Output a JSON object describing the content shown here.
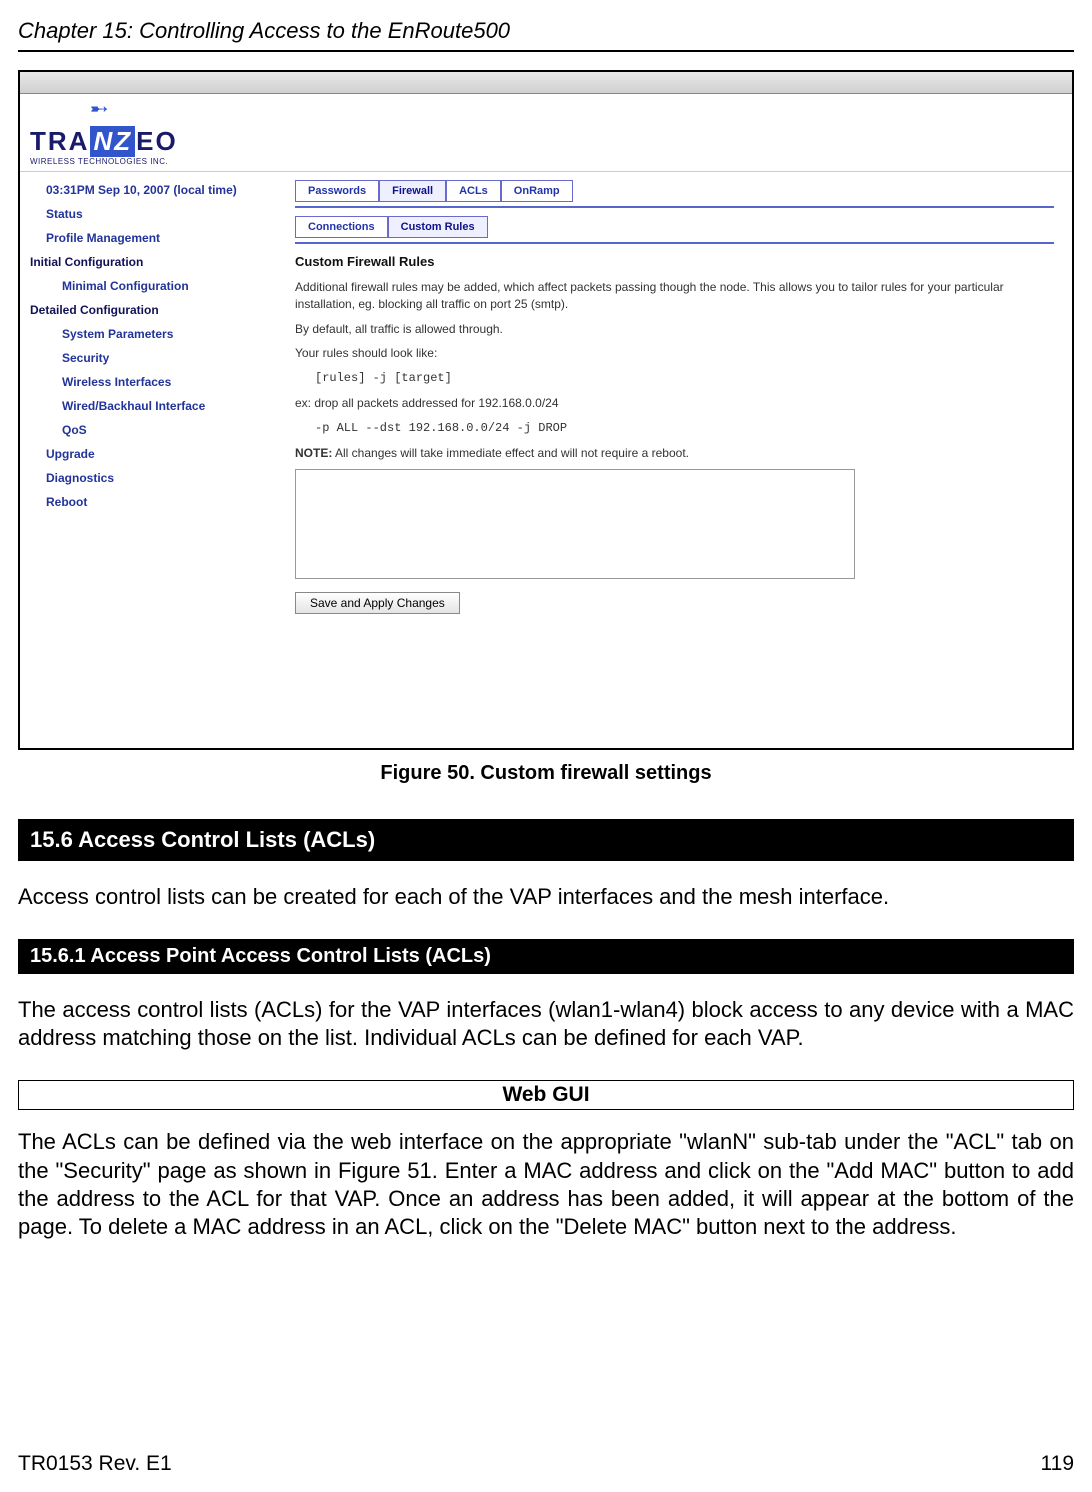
{
  "header": {
    "chapter": "Chapter 15: Controlling Access to the EnRoute500"
  },
  "screenshot": {
    "logo": {
      "pre": "TRA",
      "mid": "NZ",
      "post": "EO",
      "sub": "WIRELESS TECHNOLOGIES INC."
    },
    "sidebar": {
      "time": "03:31PM Sep 10, 2007 (local time)",
      "status": "Status",
      "profile": "Profile Management",
      "initial": "Initial Configuration",
      "minconf": "Minimal Configuration",
      "detailed": "Detailed Configuration",
      "sysparam": "System Parameters",
      "security": "Security",
      "wifaces": "Wireless Interfaces",
      "wired": "Wired/Backhaul Interface",
      "qos": "QoS",
      "upgrade": "Upgrade",
      "diag": "Diagnostics",
      "reboot": "Reboot"
    },
    "tabs1": {
      "passwords": "Passwords",
      "firewall": "Firewall",
      "acls": "ACLs",
      "onramp": "OnRamp"
    },
    "tabs2": {
      "connections": "Connections",
      "custom": "Custom Rules"
    },
    "content": {
      "title": "Custom Firewall Rules",
      "p1": "Additional firewall rules may be added, which affect packets passing though the node. This allows you to tailor rules for your particular installation, eg. blocking all traffic on port 25 (smtp).",
      "p2": "By default, all traffic is allowed through.",
      "p3": "Your rules should look like:",
      "code1": "[rules] -j [target]",
      "p4": "ex: drop all packets addressed for 192.168.0.0/24",
      "code2": "-p ALL --dst 192.168.0.0/24 -j DROP",
      "note_label": "NOTE:",
      "note_text": " All changes will take immediate effect and will not require a reboot.",
      "save_btn": "Save and Apply Changes"
    }
  },
  "figure_caption": "Figure 50. Custom firewall settings",
  "h156": "15.6    Access Control Lists (ACLs)",
  "p156": "Access control lists can be created for each of the VAP interfaces and the mesh interface.",
  "h1561": "15.6.1    Access Point Access Control Lists (ACLs)",
  "p1561": "The access control lists (ACLs) for the VAP interfaces (wlan1-wlan4) block access to any device with a MAC address matching those on the list. Individual ACLs can be defined for each VAP.",
  "webgui": "Web GUI",
  "p_webgui": "The ACLs can be defined via the web interface on the appropriate \"wlanN\" sub-tab under the \"ACL\" tab on the \"Security\" page as shown in Figure 51. Enter a MAC address and click on the \"Add MAC\" button to add the address to the ACL for that VAP. Once an address has been added, it will appear at the bottom of the page. To delete a MAC address in an ACL, click on the \"Delete MAC\" button next to the address.",
  "footer": {
    "left": "TR0153 Rev. E1",
    "right": "119"
  }
}
